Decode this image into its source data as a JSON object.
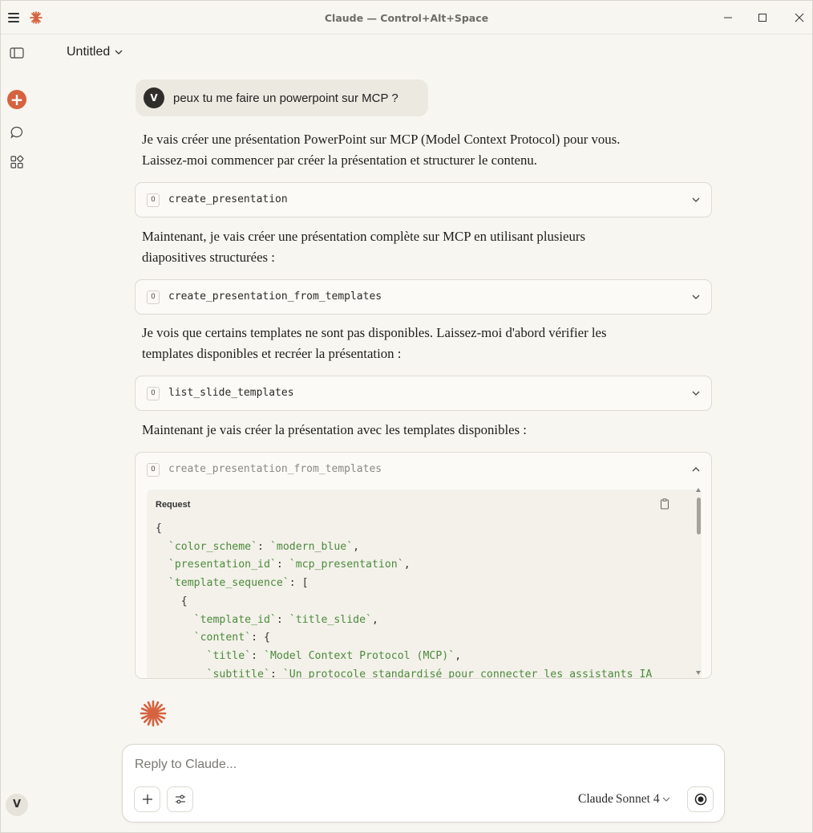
{
  "window": {
    "title": "Claude — Control+Alt+Space"
  },
  "header": {
    "doc_title": "Untitled"
  },
  "sidebar": {
    "user_initial": "V"
  },
  "conversation": {
    "user_initial": "V",
    "user_message": "peux tu me faire un powerpoint sur MCP ?",
    "para1_line1": "Je vais créer une présentation PowerPoint sur MCP (Model Context Protocol) pour vous.",
    "para1_line2": "Laissez-moi commencer par créer la présentation et structurer le contenu.",
    "tool1": "create_presentation",
    "para2_line1": "Maintenant, je vais créer une présentation complète sur MCP en utilisant plusieurs",
    "para2_line2": "diapositives structurées :",
    "tool2": "create_presentation_from_templates",
    "para3_line1": "Je vois que certains templates ne sont pas disponibles. Laissez-moi d'abord vérifier les",
    "para3_line2": "templates disponibles et recréer la présentation :",
    "tool3": "list_slide_templates",
    "para4": "Maintenant je vais créer la présentation avec les templates disponibles :",
    "tool4": "create_presentation_from_templates",
    "tool_icon_glyph": "O",
    "request_label": "Request",
    "code": {
      "l1_open": "{",
      "l2_key": "`color_scheme`",
      "l2_val": "`modern_blue`",
      "l3_key": "`presentation_id`",
      "l3_val": "`mcp_presentation`",
      "l4_key": "`template_sequence`",
      "l4_tail": ": [",
      "l5_open": "{",
      "l6_key": "`template_id`",
      "l6_val": "`title_slide`",
      "l7_key": "`content`",
      "l7_tail": ": {",
      "l8_key": "`title`",
      "l8_val": "`Model Context Protocol (MCP)`",
      "l9_key": "`subtitle`",
      "l9_val": "`Un protocole standardisé pour connecter les assistants IA"
    }
  },
  "composer": {
    "placeholder": "Reply to Claude...",
    "model_name": "Claude",
    "model_version": "Sonnet 4"
  },
  "colors": {
    "accent": "#d6623f",
    "code_string": "#4d8a3c",
    "background": "#f7f6f1"
  }
}
